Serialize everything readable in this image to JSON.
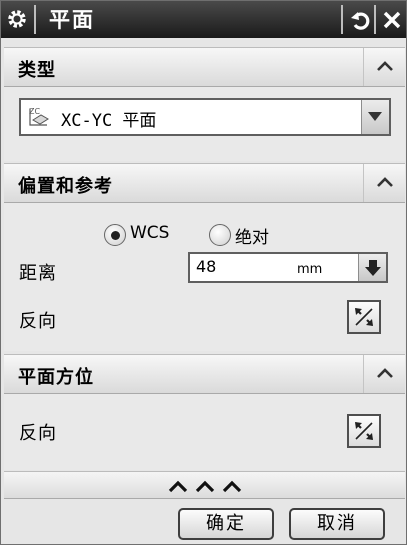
{
  "window": {
    "title": "平面"
  },
  "sections": {
    "type": {
      "header": "类型",
      "selected": "XC-YC 平面"
    },
    "offset": {
      "header": "偏置和参考",
      "radio_wcs": "WCS",
      "radio_absolute": "绝对",
      "radio_selected": "WCS",
      "distance_label": "距离",
      "distance_value": "48",
      "distance_unit": "mm",
      "reverse_label": "反向"
    },
    "orientation": {
      "header": "平面方位",
      "reverse_label": "反向"
    }
  },
  "footer": {
    "ok_label": "确定",
    "cancel_label": "取消"
  },
  "icons": [
    "gear-icon",
    "reset-icon",
    "close-icon",
    "collapse-up-icon",
    "plane-type-icon",
    "dropdown-arrow-icon",
    "flip-direction-icon",
    "more-options-icon"
  ]
}
